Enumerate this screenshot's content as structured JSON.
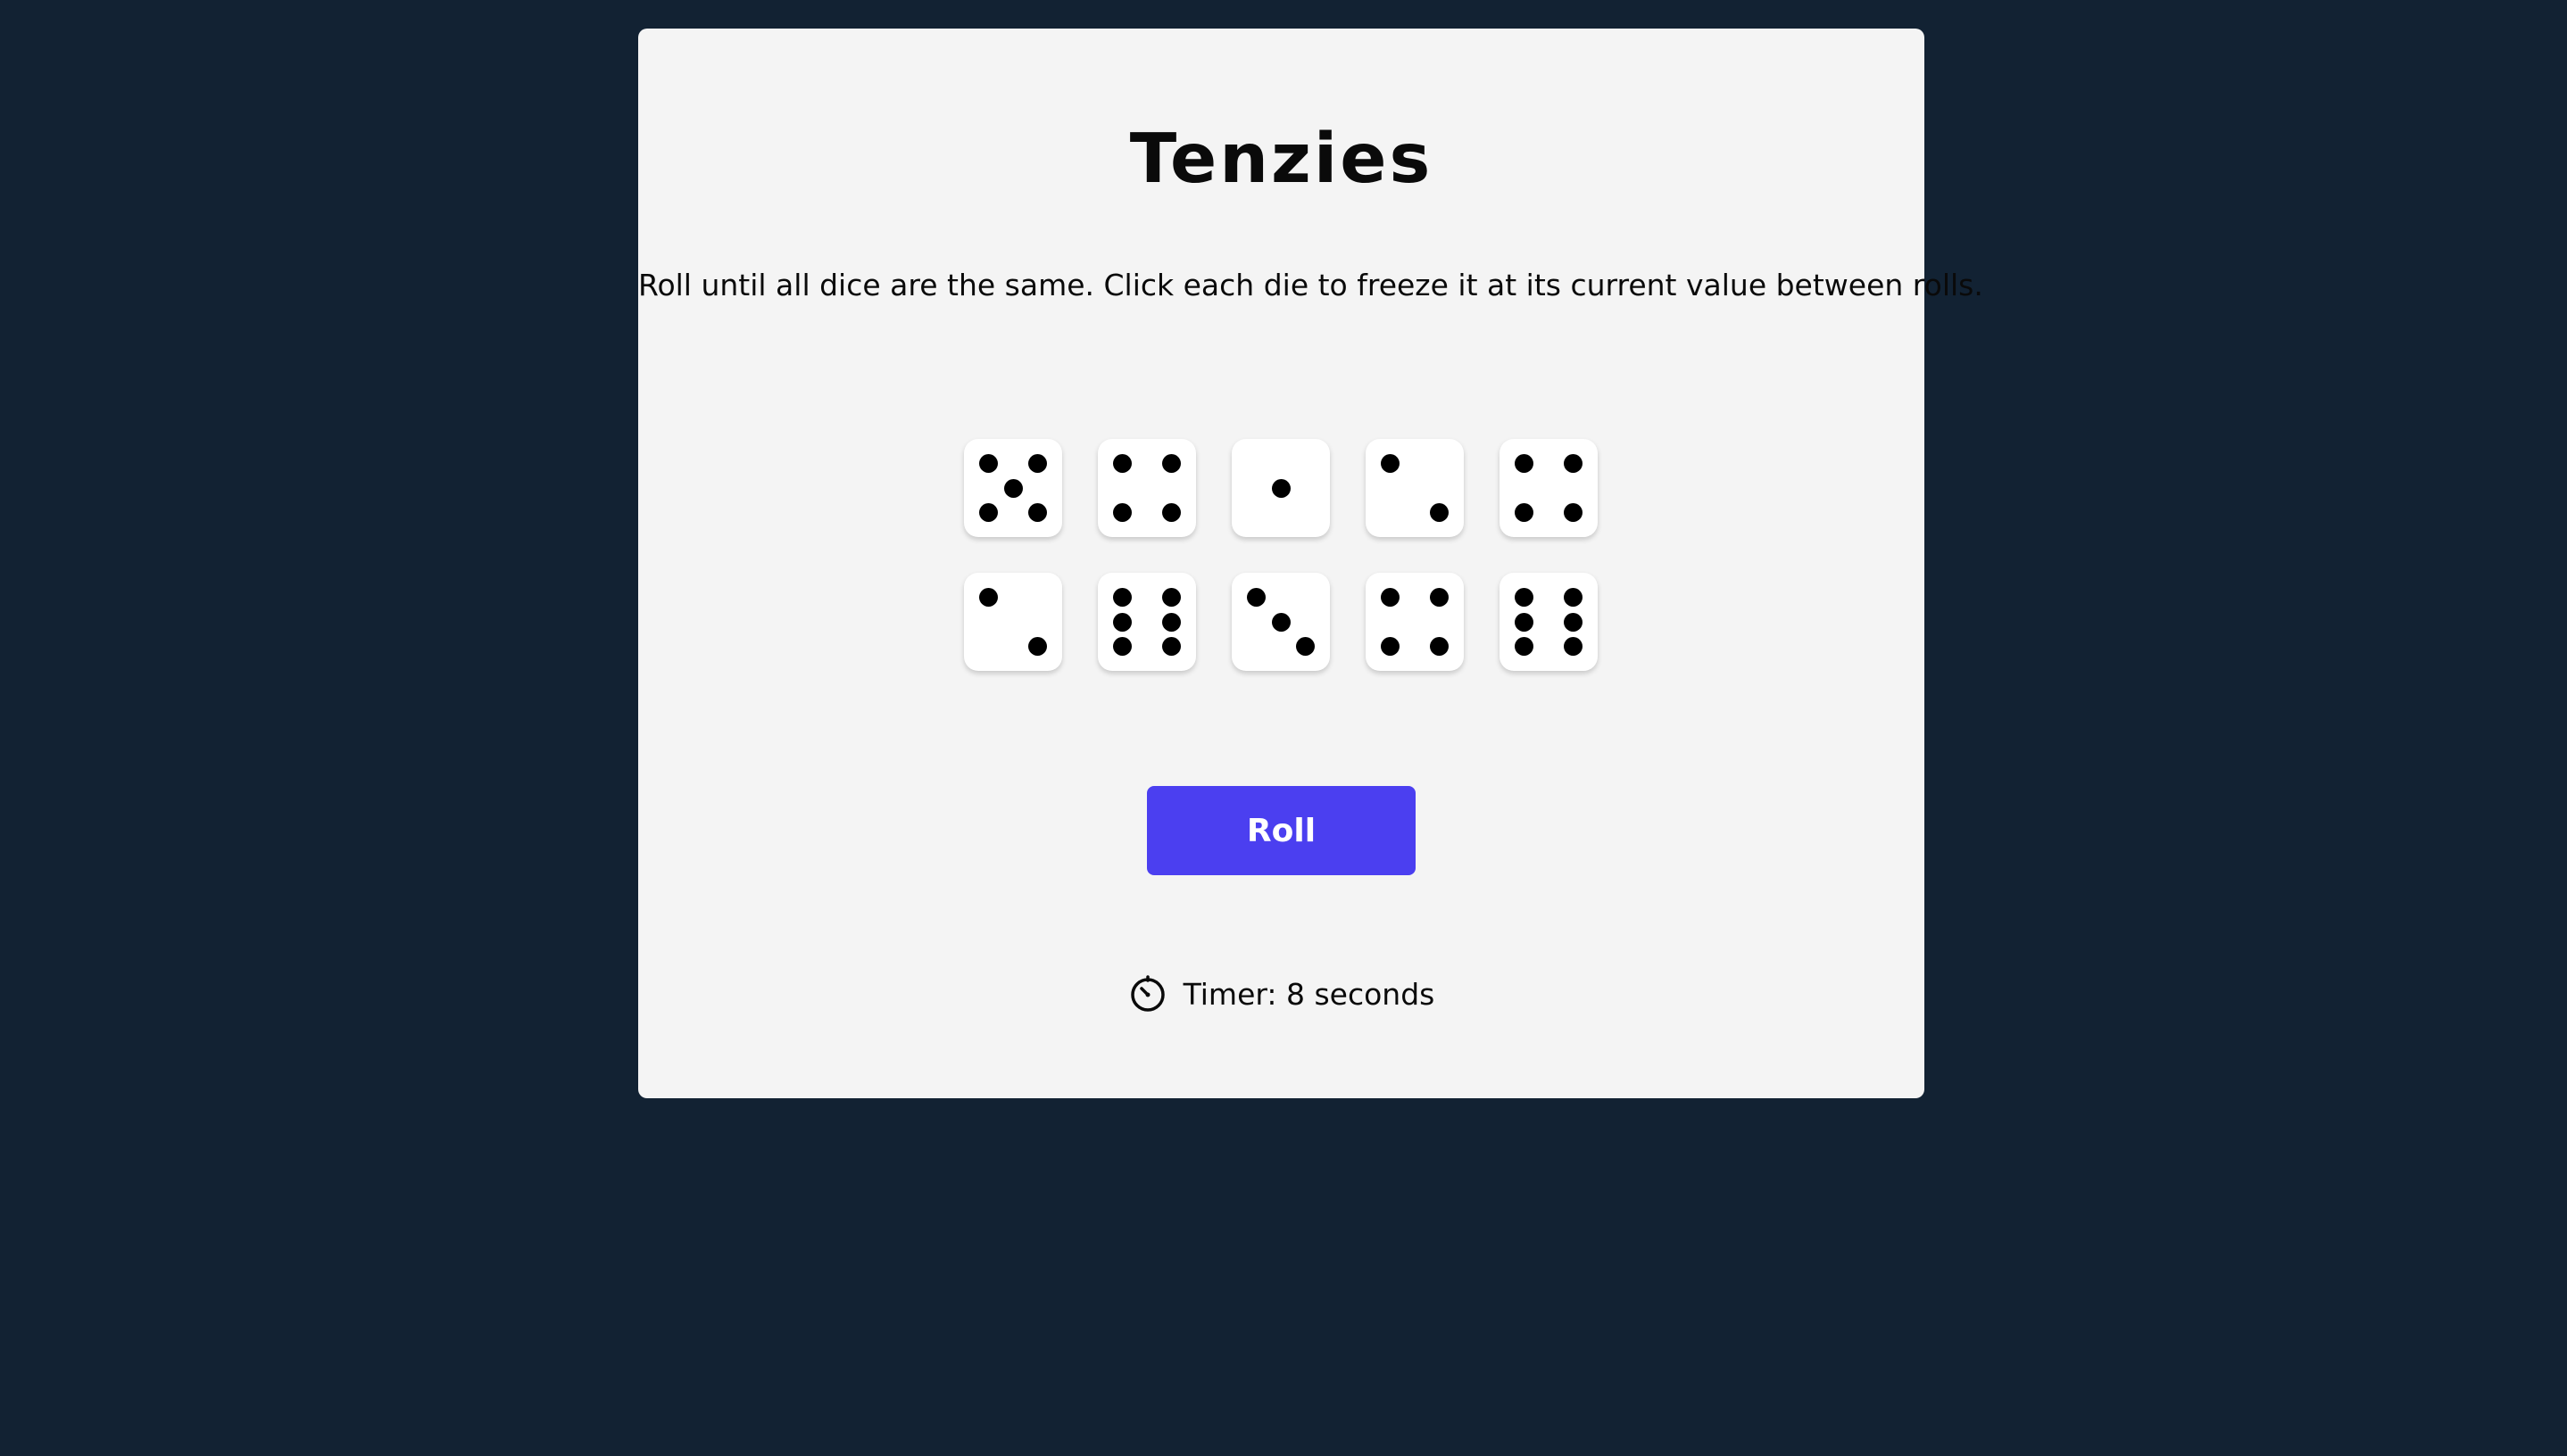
{
  "game": {
    "title": "Tenzies",
    "instructions": "Roll until all dice are the same. Click each die to freeze it at its current value between rolls.",
    "dice": [
      5,
      4,
      1,
      2,
      4,
      2,
      6,
      3,
      4,
      6
    ],
    "roll_label": "Roll",
    "timer_text": "Timer: 8 seconds",
    "timer_icon": "stopwatch-icon"
  },
  "colors": {
    "background": "#122233",
    "card": "#f4f4f4",
    "die_face": "#ffffff",
    "pip": "#000000",
    "button": "#4b3ff0",
    "button_text": "#ffffff"
  }
}
